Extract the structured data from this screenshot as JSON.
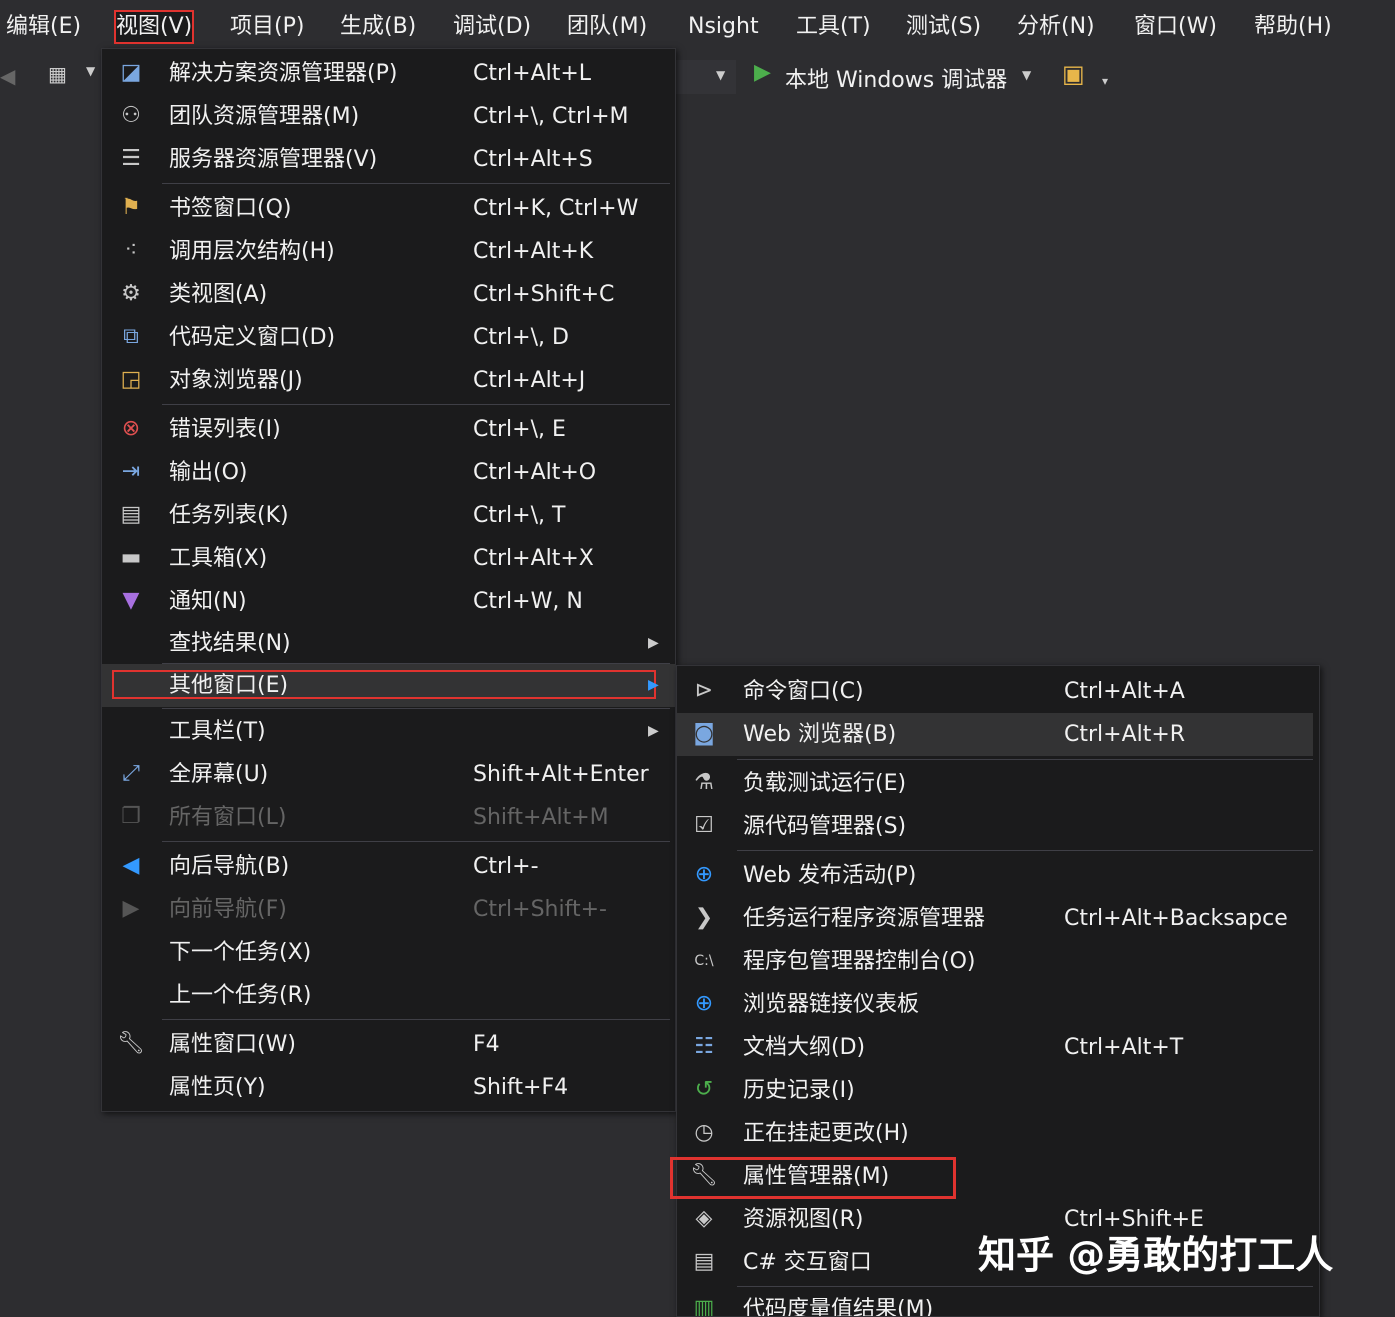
{
  "menubar": {
    "items": [
      "编辑(E)",
      "视图(V)",
      "项目(P)",
      "生成(B)",
      "调试(D)",
      "团队(M)",
      "Nsight",
      "工具(T)",
      "测试(S)",
      "分析(N)",
      "窗口(W)",
      "帮助(H)"
    ],
    "active_index": 1
  },
  "toolbar": {
    "debug_target": "本地 Windows 调试器"
  },
  "view_menu": {
    "items": [
      {
        "label": "解决方案资源管理器(P)",
        "shortcut": "Ctrl+Alt+L",
        "icon": "solution-explorer-icon"
      },
      {
        "label": "团队资源管理器(M)",
        "shortcut": "Ctrl+\\, Ctrl+M",
        "icon": "team-explorer-icon"
      },
      {
        "label": "服务器资源管理器(V)",
        "shortcut": "Ctrl+Alt+S",
        "icon": "server-explorer-icon"
      },
      {
        "label": "书签窗口(Q)",
        "shortcut": "Ctrl+K, Ctrl+W",
        "icon": "bookmark-icon"
      },
      {
        "label": "调用层次结构(H)",
        "shortcut": "Ctrl+Alt+K",
        "icon": "call-hierarchy-icon"
      },
      {
        "label": "类视图(A)",
        "shortcut": "Ctrl+Shift+C",
        "icon": "class-view-icon"
      },
      {
        "label": "代码定义窗口(D)",
        "shortcut": "Ctrl+\\, D",
        "icon": "code-definition-icon"
      },
      {
        "label": "对象浏览器(J)",
        "shortcut": "Ctrl+Alt+J",
        "icon": "object-browser-icon"
      },
      {
        "label": "错误列表(I)",
        "shortcut": "Ctrl+\\, E",
        "icon": "error-list-icon"
      },
      {
        "label": "输出(O)",
        "shortcut": "Ctrl+Alt+O",
        "icon": "output-icon"
      },
      {
        "label": "任务列表(K)",
        "shortcut": "Ctrl+\\, T",
        "icon": "task-list-icon"
      },
      {
        "label": "工具箱(X)",
        "shortcut": "Ctrl+Alt+X",
        "icon": "toolbox-icon"
      },
      {
        "label": "通知(N)",
        "shortcut": "Ctrl+W, N",
        "icon": "notification-icon"
      },
      {
        "label": "查找结果(N)",
        "shortcut": "",
        "icon": ""
      },
      {
        "label": "其他窗口(E)",
        "shortcut": "",
        "icon": ""
      },
      {
        "label": "工具栏(T)",
        "shortcut": "",
        "icon": ""
      },
      {
        "label": "全屏幕(U)",
        "shortcut": "Shift+Alt+Enter",
        "icon": "fullscreen-icon"
      },
      {
        "label": "所有窗口(L)",
        "shortcut": "Shift+Alt+M",
        "icon": "all-windows-icon"
      },
      {
        "label": "向后导航(B)",
        "shortcut": "Ctrl+-",
        "icon": "navigate-back-icon"
      },
      {
        "label": "向前导航(F)",
        "shortcut": "Ctrl+Shift+-",
        "icon": "navigate-forward-icon"
      },
      {
        "label": "下一个任务(X)",
        "shortcut": "",
        "icon": ""
      },
      {
        "label": "上一个任务(R)",
        "shortcut": "",
        "icon": ""
      },
      {
        "label": "属性窗口(W)",
        "shortcut": "F4",
        "icon": "wrench-icon"
      },
      {
        "label": "属性页(Y)",
        "shortcut": "Shift+F4",
        "icon": ""
      }
    ]
  },
  "other_windows_menu": {
    "items": [
      {
        "label": "命令窗口(C)",
        "shortcut": "Ctrl+Alt+A",
        "icon": "command-window-icon"
      },
      {
        "label": "Web 浏览器(B)",
        "shortcut": "Ctrl+Alt+R",
        "icon": "web-browser-icon"
      },
      {
        "label": "负载测试运行(E)",
        "shortcut": "",
        "icon": "load-test-icon"
      },
      {
        "label": "源代码管理器(S)",
        "shortcut": "",
        "icon": "source-control-icon"
      },
      {
        "label": "Web 发布活动(P)",
        "shortcut": "",
        "icon": "web-publish-icon"
      },
      {
        "label": "任务运行程序资源管理器",
        "shortcut": "Ctrl+Alt+Backsapce",
        "icon": "task-runner-icon"
      },
      {
        "label": "程序包管理器控制台(O)",
        "shortcut": "",
        "icon": "package-console-icon"
      },
      {
        "label": "浏览器链接仪表板",
        "shortcut": "",
        "icon": "browser-link-icon"
      },
      {
        "label": "文档大纲(D)",
        "shortcut": "Ctrl+Alt+T",
        "icon": "document-outline-icon"
      },
      {
        "label": "历史记录(I)",
        "shortcut": "",
        "icon": "history-icon"
      },
      {
        "label": "正在挂起更改(H)",
        "shortcut": "",
        "icon": "pending-changes-icon"
      },
      {
        "label": "属性管理器(M)",
        "shortcut": "",
        "icon": "wrench-icon"
      },
      {
        "label": "资源视图(R)",
        "shortcut": "Ctrl+Shift+E",
        "icon": "resource-view-icon"
      },
      {
        "label": "C# 交互窗口",
        "shortcut": "",
        "icon": "csharp-interactive-icon"
      },
      {
        "label": "代码度量值结果(M)",
        "shortcut": "",
        "icon": "code-metrics-icon"
      }
    ]
  },
  "watermark": "知乎 @勇敢的打工人",
  "colors": {
    "highlight_box": "#e0332f",
    "menu_bg": "#1b1b1c",
    "ide_bg": "#2d2d30",
    "accent_blue": "#3399ff",
    "play_green": "#4cae4c"
  }
}
